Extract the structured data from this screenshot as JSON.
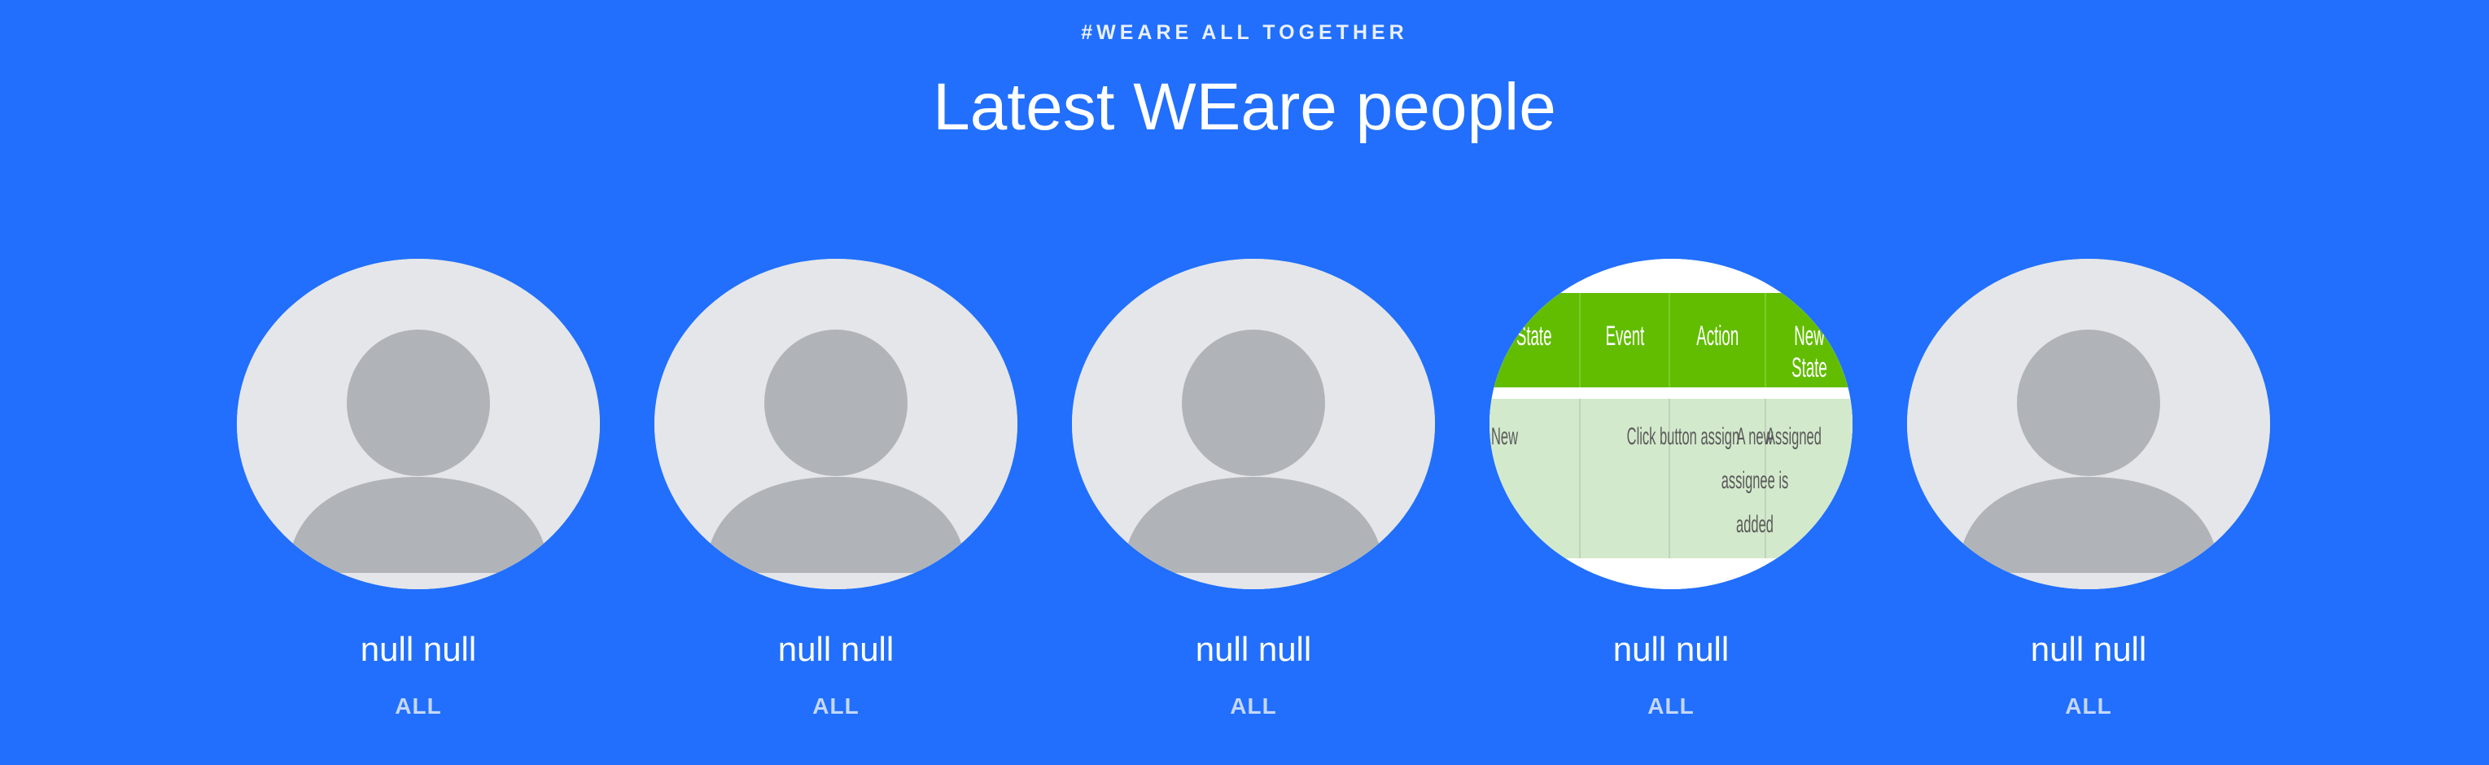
{
  "header": {
    "eyebrow": "#WEARE ALL TOGETHER",
    "title": "Latest WEare people"
  },
  "people": [
    {
      "name": "null null",
      "role": "ALL",
      "avatar": "default-avatar"
    },
    {
      "name": "null null",
      "role": "ALL",
      "avatar": "default-avatar"
    },
    {
      "name": "null null",
      "role": "ALL",
      "avatar": "default-avatar"
    },
    {
      "name": "null null",
      "role": "ALL",
      "avatar": "table-image"
    },
    {
      "name": "null null",
      "role": "ALL",
      "avatar": "default-avatar"
    }
  ],
  "table_image": {
    "headers": [
      "State",
      "Event",
      "Action",
      "New State"
    ],
    "row": [
      "New",
      "Click button assign",
      "A new assignee is added",
      "Assigned"
    ]
  },
  "colors": {
    "background": "#216ffc",
    "avatar_bg": "#e4e6e9",
    "avatar_figure": "#b0b4b8",
    "table_header": "#62bd00",
    "table_body": "#d3e9cc"
  }
}
